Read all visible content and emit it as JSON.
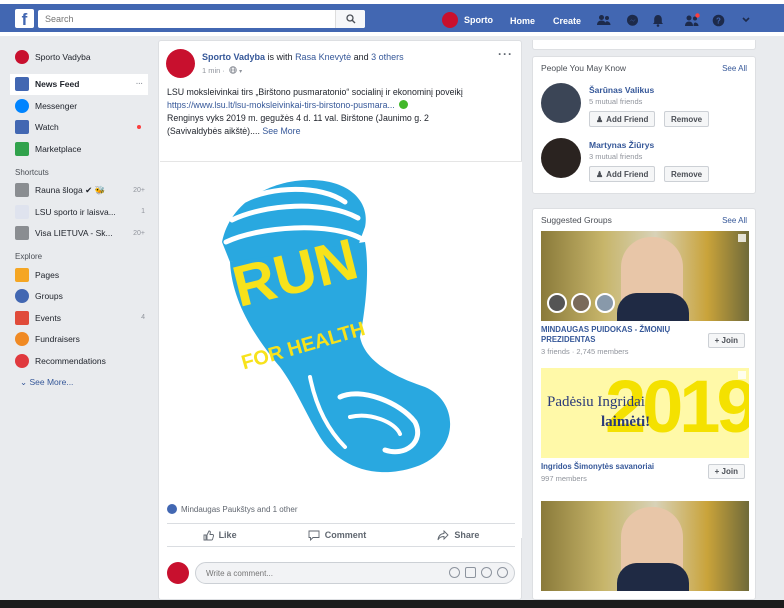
{
  "topbar": {
    "logo": "f",
    "search_placeholder": "Search",
    "profile_name": "Sporto",
    "home": "Home",
    "create": "Create"
  },
  "sidebar": {
    "profile": "Sporto Vadyba",
    "items": [
      {
        "label": "News Feed",
        "meta": "···",
        "color": "#4267b2"
      },
      {
        "label": "Messenger",
        "meta": "",
        "color": "#0084ff"
      },
      {
        "label": "Watch",
        "meta": "",
        "color": "#4267b2"
      },
      {
        "label": "Marketplace",
        "meta": "",
        "color": "#31a24c"
      }
    ],
    "shortcuts_title": "Shortcuts",
    "shortcuts": [
      {
        "label": "Rauna šloga ✔ 🐝",
        "meta": "20+"
      },
      {
        "label": "LSU sporto ir laisva...",
        "meta": "1"
      },
      {
        "label": "Visa LIETUVA - Sk...",
        "meta": "20+"
      }
    ],
    "explore_title": "Explore",
    "explore": [
      {
        "label": "Pages",
        "meta": "",
        "color": "#f5a623"
      },
      {
        "label": "Groups",
        "meta": "",
        "color": "#4267b2"
      },
      {
        "label": "Events",
        "meta": "4",
        "color": "#e04b3a"
      },
      {
        "label": "Fundraisers",
        "meta": "",
        "color": "#f08a24"
      },
      {
        "label": "Recommendations",
        "meta": "",
        "color": "#e0393e"
      }
    ],
    "see_more": "⌄ See More..."
  },
  "post": {
    "author": "Sporto Vadyba",
    "with_text": "is with",
    "tagged": "Rasa Knevytė",
    "and_text": "and",
    "others": "3 others",
    "time": "1 min ·",
    "audience_icon": "globe-icon",
    "more": "···",
    "text_line1": "LSU moksleivinkai tirs „Birštono pusmaratonio“ socialinį ir ekonominį poveikį",
    "url": "https://www.lsu.lt/lsu-moksleivinkai-tirs-birstono-pusmara...",
    "text_line2": "Renginys vyks 2019 m. gegužės 4 d. 11 val. Birštone (Jaunimo g. 2",
    "text_line3": "(Savivaldybės aikštė)....",
    "see_more": "See More",
    "image_text_top": "RUN",
    "image_text_bottom": "FOR HEALTH",
    "likes_text": "Mindaugas Paukštys and 1 other",
    "like_label": "Like",
    "comment_label": "Comment",
    "share_label": "Share",
    "comment_placeholder": "Write a comment..."
  },
  "pymk": {
    "title": "People You May Know",
    "see_all": "See All",
    "people": [
      {
        "name": "Šarūnas Valikus",
        "mutual": "5 mutual friends",
        "add": "Add Friend",
        "remove": "Remove"
      },
      {
        "name": "Martynas Žiūrys",
        "mutual": "3 mutual friends",
        "add": "Add Friend",
        "remove": "Remove"
      }
    ]
  },
  "groups": {
    "title": "Suggested Groups",
    "see_all": "See All",
    "items": [
      {
        "name": "MINDAUGAS PUIDOKAS - ŽMONIŲ PREZIDENTAS",
        "meta": "3 friends · 2,745 members",
        "join": "+ Join"
      },
      {
        "name": "Ingridos Šimonytės savanoriai",
        "meta": "997 members",
        "join": "+ Join",
        "banner_year": "2019",
        "banner_line1": "Padėsiu Ingridai",
        "banner_line2": "laimėti!"
      },
      {
        "name": "",
        "meta": "",
        "join": ""
      }
    ]
  },
  "colors": {
    "brand": "#4267b2",
    "link": "#365899",
    "run_blue": "#29a8e0",
    "run_yellow": "#f7e21b"
  }
}
